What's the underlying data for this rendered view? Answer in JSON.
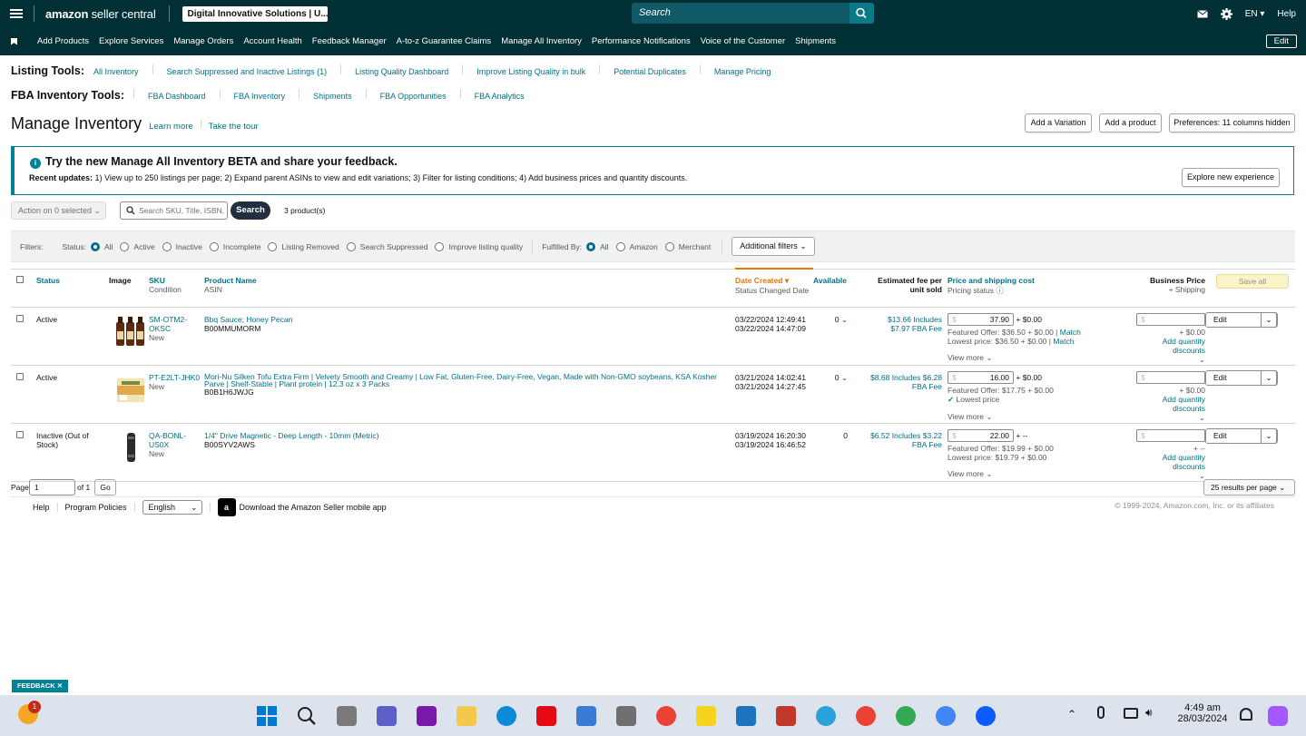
{
  "topbar": {
    "logo_main": "amazon",
    "logo_sub": "seller central",
    "store_name": "Digital Innovative Solutions | U...",
    "search_placeholder": "Search",
    "language": "EN",
    "help": "Help"
  },
  "nav": {
    "items": [
      "Add Products",
      "Explore Services",
      "Manage Orders",
      "Account Health",
      "Feedback Manager",
      "A-to-z Guarantee Claims",
      "Manage All Inventory",
      "Performance Notifications",
      "Voice of the Customer",
      "Shipments"
    ],
    "edit": "Edit"
  },
  "listing_tools": {
    "title": "Listing Tools:",
    "links": [
      "All Inventory",
      "Search Suppressed and Inactive Listings (1)",
      "Listing Quality Dashboard",
      "Improve Listing Quality in bulk",
      "Potential Duplicates",
      "Manage Pricing"
    ]
  },
  "fba_tools": {
    "title": "FBA Inventory Tools:",
    "links": [
      "FBA Dashboard",
      "FBA Inventory",
      "Shipments",
      "FBA Opportunities",
      "FBA Analytics"
    ]
  },
  "page": {
    "title": "Manage Inventory",
    "learn_more": "Learn more",
    "take_tour": "Take the tour",
    "add_variation": "Add a Variation",
    "add_product": "Add a product",
    "preferences": "Preferences: 11 columns hidden"
  },
  "banner": {
    "heading": "Try the new Manage All Inventory BETA and share your feedback.",
    "label": "Recent updates:",
    "text": "1) View up to 250 listings per page; 2) Expand parent ASINs to view and edit variations; 3) Filter for listing conditions; 4) Add business prices and quantity discounts.",
    "button": "Explore new experience"
  },
  "toolbar": {
    "action": "Action on 0 selected",
    "search_placeholder": "Search SKU, Title, ISBN,",
    "search_button": "Search",
    "count": "3 product(s)"
  },
  "filters": {
    "label": "Filters:",
    "status_label": "Status:",
    "status_options": [
      "All",
      "Active",
      "Inactive",
      "Incomplete",
      "Listing Removed",
      "Search Suppressed",
      "Improve listing quality"
    ],
    "fulfilled_label": "Fulfilled By:",
    "fulfilled_options": [
      "All",
      "Amazon",
      "Merchant"
    ],
    "additional": "Additional filters"
  },
  "columns": {
    "status": "Status",
    "image": "Image",
    "sku": "SKU",
    "condition": "Condition",
    "product_name": "Product Name",
    "asin": "ASIN",
    "date_created": "Date Created",
    "status_changed": "Status Changed Date",
    "available": "Available",
    "fee": "Estimated fee per unit sold",
    "price": "Price and shipping cost",
    "pricing_status": "Pricing status",
    "business_price": "Business Price",
    "plus_shipping": "+ Shipping",
    "save_all": "Save all"
  },
  "rows": [
    {
      "status": "Active",
      "sku": "SM-OTM2-OKSC",
      "condition": "New",
      "name": "Bbq Sauce; Honey Pecan",
      "asin": "B00MMUMORM",
      "created": "03/22/2024 12:49:41",
      "changed": "03/22/2024 14:47:09",
      "available": "0",
      "fee": "$13.66 Includes $7.97 FBA Fee",
      "price": "37.90",
      "shipping": "+ $0.00",
      "line1": "Featured Offer: $36.50 + $0.00",
      "line1_link": "Match",
      "line2": "Lowest price: $36.50 + $0.00",
      "line2_link": "Match",
      "view_more": "View more",
      "biz_ship": "+ $0.00",
      "qty_disc": "Add quantity discounts",
      "edit": "Edit"
    },
    {
      "status": "Active",
      "sku": "PT-E2LT-JHK0",
      "condition": "New",
      "name": "Mori-Nu Silken Tofu Extra Firm | Velvety Smooth and Creamy | Low Fat, Gluten-Free, Dairy-Free, Vegan, Made with Non-GMO soybeans, KSA Kosher Parve | Shelf-Stable | Plant protein | 12.3 oz x 3 Packs",
      "asin": "B0B1H6JWJG",
      "created": "03/21/2024 14:02:41",
      "changed": "03/21/2024 14:27:45",
      "available": "0",
      "fee": "$8.68 Includes $6.28 FBA Fee",
      "price": "16.00",
      "shipping": "+ $0.00",
      "line1": "Featured Offer: $17.75 + $0.00",
      "line2": "Lowest price",
      "view_more": "View more",
      "biz_ship": "+ $0.00",
      "qty_disc": "Add quantity discounts",
      "edit": "Edit"
    },
    {
      "status": "Inactive (Out of Stock)",
      "sku": "QA-BONL-US0X",
      "condition": "New",
      "name": "1/4\" Drive Magnetic - Deep Length - 10mm (Metric)",
      "asin": "B00SYV2AWS",
      "created": "03/19/2024 16:20:30",
      "changed": "03/19/2024 16:46:52",
      "available": "0",
      "fee": "$6.52 Includes $3.22 FBA Fee",
      "price": "22.00",
      "shipping": "+ --",
      "line1": "Featured Offer: $19.99 + $0.00",
      "line2": "Lowest price: $19.79 + $0.00",
      "view_more": "View more",
      "biz_ship": "+ --",
      "qty_disc": "Add quantity discounts",
      "edit": "Edit"
    }
  ],
  "pagination": {
    "page_label": "Page",
    "page_value": "1",
    "of_label": "of 1",
    "go": "Go",
    "per_page": "25 results per page"
  },
  "footer": {
    "help": "Help",
    "policies": "Program Policies",
    "language": "English",
    "app": "Download the Amazon Seller mobile app",
    "copyright": "© 1999-2024, Amazon.com, Inc. or its affiliates"
  },
  "feedback": "FEEDBACK",
  "taskbar": {
    "time": "4:49 am",
    "date": "28/03/2024",
    "weather_badge": "1"
  },
  "colors": {
    "header_bg": "#002f36",
    "link": "#007185",
    "accent_orange": "#e77600"
  }
}
